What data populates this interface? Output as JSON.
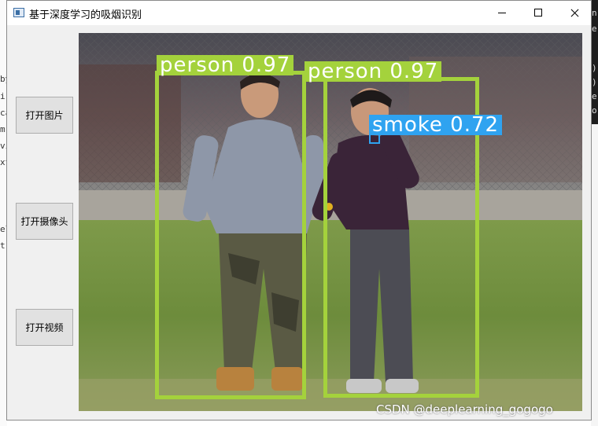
{
  "window": {
    "title": "基于深度学习的吸烟识别"
  },
  "buttons": {
    "open_image": "打开图片",
    "open_camera": "打开摄像头",
    "open_video": "打开视频"
  },
  "detections": [
    {
      "label": "person 0.97",
      "color": "#a4d23c",
      "text_color": "#ffffff"
    },
    {
      "label": "person 0.97",
      "color": "#a4d23c",
      "text_color": "#ffffff"
    },
    {
      "label": "smoke 0.72",
      "color": "#2fa3f0",
      "text_color": "#ffffff"
    }
  ],
  "watermark": "CSDN @deeplearning_gogogo",
  "background_snippets": {
    "left": [
      "by",
      "i",
      "ca",
      "m",
      "vi",
      "xt",
      "el",
      "t."
    ],
    "right": [
      "n",
      "e",
      ")",
      ")",
      "e",
      "o"
    ]
  }
}
